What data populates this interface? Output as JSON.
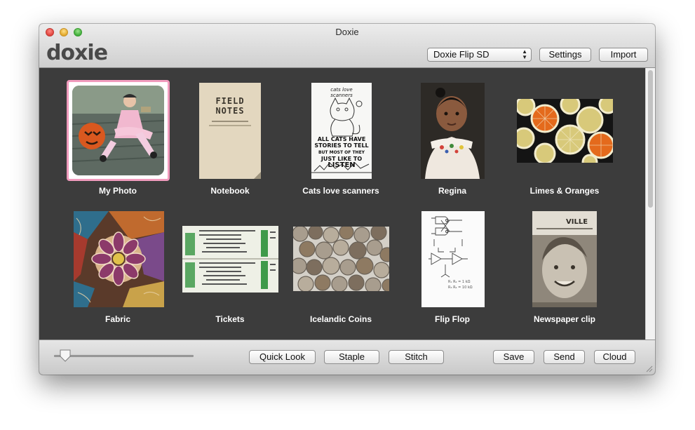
{
  "window": {
    "title": "Doxie"
  },
  "app": {
    "logo": "doxie"
  },
  "toolbar": {
    "device_select": {
      "value": "Doxie Flip SD"
    },
    "settings_label": "Settings",
    "import_label": "Import"
  },
  "items": [
    {
      "label": "My Photo",
      "selected": true,
      "icon": "photo-girl-pumpkin"
    },
    {
      "label": "Notebook",
      "icon": "field-notes-notebook"
    },
    {
      "label": "Cats love scanners",
      "icon": "cat-drawing"
    },
    {
      "label": "Regina",
      "icon": "photo-child"
    },
    {
      "label": "Limes & Oranges",
      "icon": "citrus-slices"
    },
    {
      "label": "Fabric",
      "icon": "fabric-pattern"
    },
    {
      "label": "Tickets",
      "icon": "ticket-stubs"
    },
    {
      "label": "Icelandic Coins",
      "icon": "coins"
    },
    {
      "label": "Flip Flop",
      "icon": "circuit-sketch"
    },
    {
      "label": "Newspaper clip",
      "icon": "newspaper-photo"
    }
  ],
  "thumbs": {
    "notebook_title_1": "FIELD",
    "notebook_title_2": "NOTES",
    "cats_line_1": "cats love",
    "cats_line_2": "scanners",
    "cats_line_3": "ALL CATS HAVE",
    "cats_line_4": "STORIES TO TELL",
    "cats_line_5": "BUT MOST OF THEY",
    "cats_line_6": "JUST LIKE TO",
    "cats_line_7": "LISTEN",
    "newspaper_text": "VILLE"
  },
  "bottom": {
    "zoom_slider_value": 0.08,
    "quick_look_label": "Quick Look",
    "staple_label": "Staple",
    "stitch_label": "Stitch",
    "save_label": "Save",
    "send_label": "Send",
    "cloud_label": "Cloud"
  },
  "colors": {
    "selection": "#f19bbd",
    "content_bg": "#3c3c3c"
  }
}
